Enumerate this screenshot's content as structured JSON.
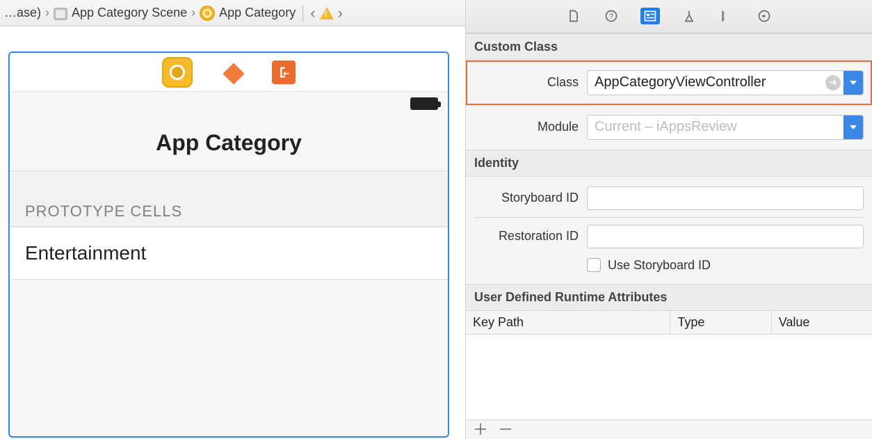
{
  "breadcrumb": {
    "root": "…ase)",
    "scene": "App Category Scene",
    "item": "App Category"
  },
  "device": {
    "title": "App Category",
    "prototype_label": "PROTOTYPE CELLS",
    "cell_text": "Entertainment"
  },
  "inspector": {
    "customClass": {
      "header": "Custom Class",
      "class_label": "Class",
      "class_value": "AppCategoryViewController",
      "module_label": "Module",
      "module_placeholder": "Current – iAppsReview"
    },
    "identity": {
      "header": "Identity",
      "storyboard_label": "Storyboard ID",
      "storyboard_value": "",
      "restoration_label": "Restoration ID",
      "restoration_value": "",
      "checkbox_label": "Use Storyboard ID"
    },
    "runtimeAttrs": {
      "header": "User Defined Runtime Attributes",
      "col1": "Key Path",
      "col2": "Type",
      "col3": "Value"
    }
  }
}
